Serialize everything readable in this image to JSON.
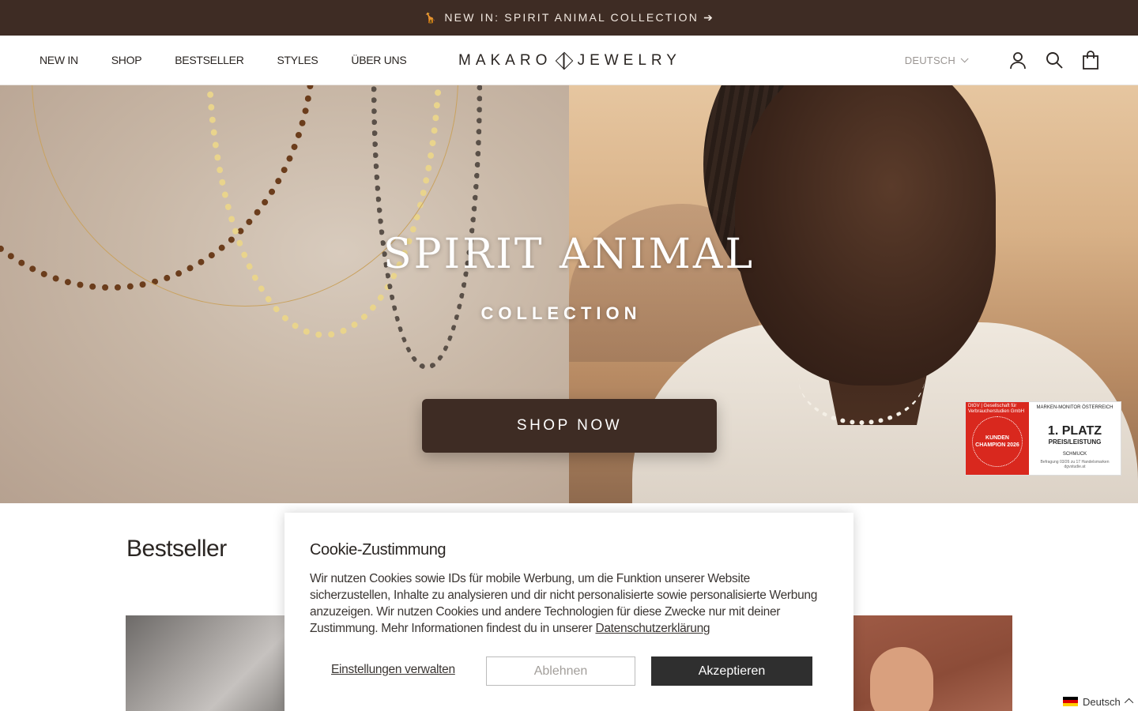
{
  "announcement": {
    "icon": "giraffe-icon",
    "text": "NEW IN: SPIRIT ANIMAL COLLECTION ➔"
  },
  "header": {
    "nav": [
      "NEW IN",
      "SHOP",
      "BESTSELLER",
      "STYLES",
      "ÜBER UNS"
    ],
    "logo_left": "MAKARO",
    "logo_right": "JEWELRY",
    "language": "DEUTSCH"
  },
  "hero": {
    "title": "SPIRIT ANIMAL",
    "subtitle": "COLLECTION",
    "cta": "SHOP NOW",
    "badge": {
      "org_label": "DtGV | Gesellschaft für Verbraucherstudien GmbH",
      "award": "KUNDEN CHAMPION 2026",
      "monitor": "MARKEN-MONITOR ÖSTERREICH",
      "rank": "1. PLATZ",
      "category": "PREIS/LEISTUNG",
      "segment": "SCHMUCK",
      "footnote": "Befragung 03/26 zu 17 Handelsmarken dgvstudie.at"
    }
  },
  "bestseller": {
    "title": "Bestseller"
  },
  "cookie": {
    "title": "Cookie-Zustimmung",
    "text": "Wir nutzen Cookies sowie IDs für mobile Werbung, um die Funktion unserer Website sicherzustellen, Inhalte zu analysieren und dir nicht personalisierte sowie personalisierte Werbung anzuzeigen. Wir nutzen Cookies und andere Technologien für diese Zwecke nur mit deiner Zustimmung. Mehr Informationen findest du in unserer ",
    "link": "Datenschutzerklärung",
    "manage": "Einstellungen verwalten",
    "decline": "Ablehnen",
    "accept": "Akzeptieren"
  },
  "language_switcher": {
    "label": "Deutsch",
    "flag_colors": [
      "#000000",
      "#dd0000",
      "#ffce00"
    ]
  }
}
